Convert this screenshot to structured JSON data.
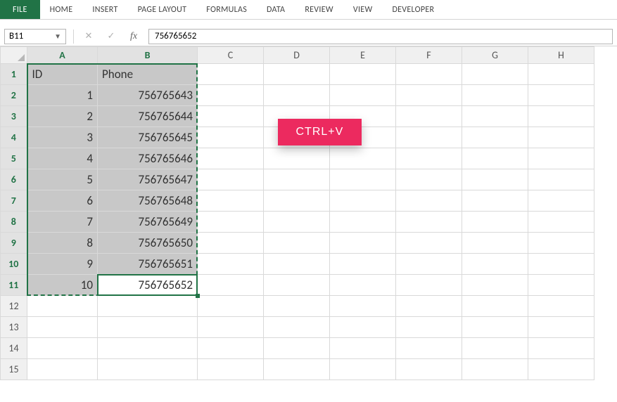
{
  "ribbon": {
    "tabs": [
      "FILE",
      "HOME",
      "INSERT",
      "PAGE LAYOUT",
      "FORMULAS",
      "DATA",
      "REVIEW",
      "VIEW",
      "DEVELOPER"
    ]
  },
  "namebox": {
    "value": "B11"
  },
  "formula_bar": {
    "value": "756765652"
  },
  "columns": [
    "A",
    "B",
    "C",
    "D",
    "E",
    "F",
    "G",
    "H"
  ],
  "rows": [
    "1",
    "2",
    "3",
    "4",
    "5",
    "6",
    "7",
    "8",
    "9",
    "10",
    "11",
    "12",
    "13",
    "14",
    "15"
  ],
  "selected_cols": [
    "A",
    "B"
  ],
  "selected_rows": [
    "1",
    "2",
    "3",
    "4",
    "5",
    "6",
    "7",
    "8",
    "9",
    "10",
    "11"
  ],
  "active_cell": "B11",
  "chart_data": {
    "type": "table",
    "headers": [
      "ID",
      "Phone"
    ],
    "rows": [
      [
        1,
        756765643
      ],
      [
        2,
        756765644
      ],
      [
        3,
        756765645
      ],
      [
        4,
        756765646
      ],
      [
        5,
        756765647
      ],
      [
        6,
        756765648
      ],
      [
        7,
        756765649
      ],
      [
        8,
        756765650
      ],
      [
        9,
        756765651
      ],
      [
        10,
        756765652
      ]
    ]
  },
  "cells": {
    "A1": {
      "v": "ID",
      "t": "txt"
    },
    "B1": {
      "v": "Phone",
      "t": "txt"
    },
    "A2": {
      "v": "1",
      "t": "num"
    },
    "B2": {
      "v": "756765643",
      "t": "num"
    },
    "A3": {
      "v": "2",
      "t": "num"
    },
    "B3": {
      "v": "756765644",
      "t": "num"
    },
    "A4": {
      "v": "3",
      "t": "num"
    },
    "B4": {
      "v": "756765645",
      "t": "num"
    },
    "A5": {
      "v": "4",
      "t": "num"
    },
    "B5": {
      "v": "756765646",
      "t": "num"
    },
    "A6": {
      "v": "5",
      "t": "num"
    },
    "B6": {
      "v": "756765647",
      "t": "num"
    },
    "A7": {
      "v": "6",
      "t": "num"
    },
    "B7": {
      "v": "756765648",
      "t": "num"
    },
    "A8": {
      "v": "7",
      "t": "num"
    },
    "B8": {
      "v": "756765649",
      "t": "num"
    },
    "A9": {
      "v": "8",
      "t": "num"
    },
    "B9": {
      "v": "756765650",
      "t": "num"
    },
    "A10": {
      "v": "9",
      "t": "num"
    },
    "B10": {
      "v": "756765651",
      "t": "num"
    },
    "A11": {
      "v": "10",
      "t": "num"
    },
    "B11": {
      "v": "756765652",
      "t": "num"
    }
  },
  "annotation": {
    "label": "CTRL+V"
  }
}
